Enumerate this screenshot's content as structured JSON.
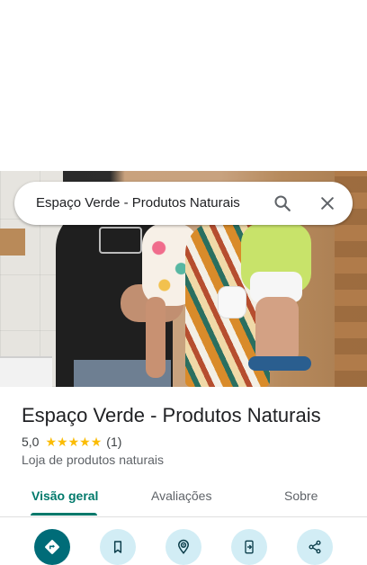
{
  "search": {
    "query": "Espaço Verde - Produtos Naturais",
    "search_icon": "search-icon",
    "close_icon": "close-icon"
  },
  "place": {
    "name": "Espaço Verde - Produtos Naturais",
    "rating": "5,0",
    "stars": 5,
    "reviews_count": "(1)",
    "category": "Loja de produtos naturais"
  },
  "tabs": [
    {
      "label": "Visão geral",
      "active": true
    },
    {
      "label": "Avaliações",
      "active": false
    },
    {
      "label": "Sobre",
      "active": false
    }
  ],
  "actions": [
    {
      "icon": "directions-icon"
    },
    {
      "icon": "bookmark-icon"
    },
    {
      "icon": "nearby-icon"
    },
    {
      "icon": "send-to-phone-icon"
    },
    {
      "icon": "share-icon"
    }
  ],
  "colors": {
    "accent": "#00796b",
    "action_bg": "#d2edf5",
    "primary_action_bg": "#006c78",
    "star": "#fbbc04"
  }
}
